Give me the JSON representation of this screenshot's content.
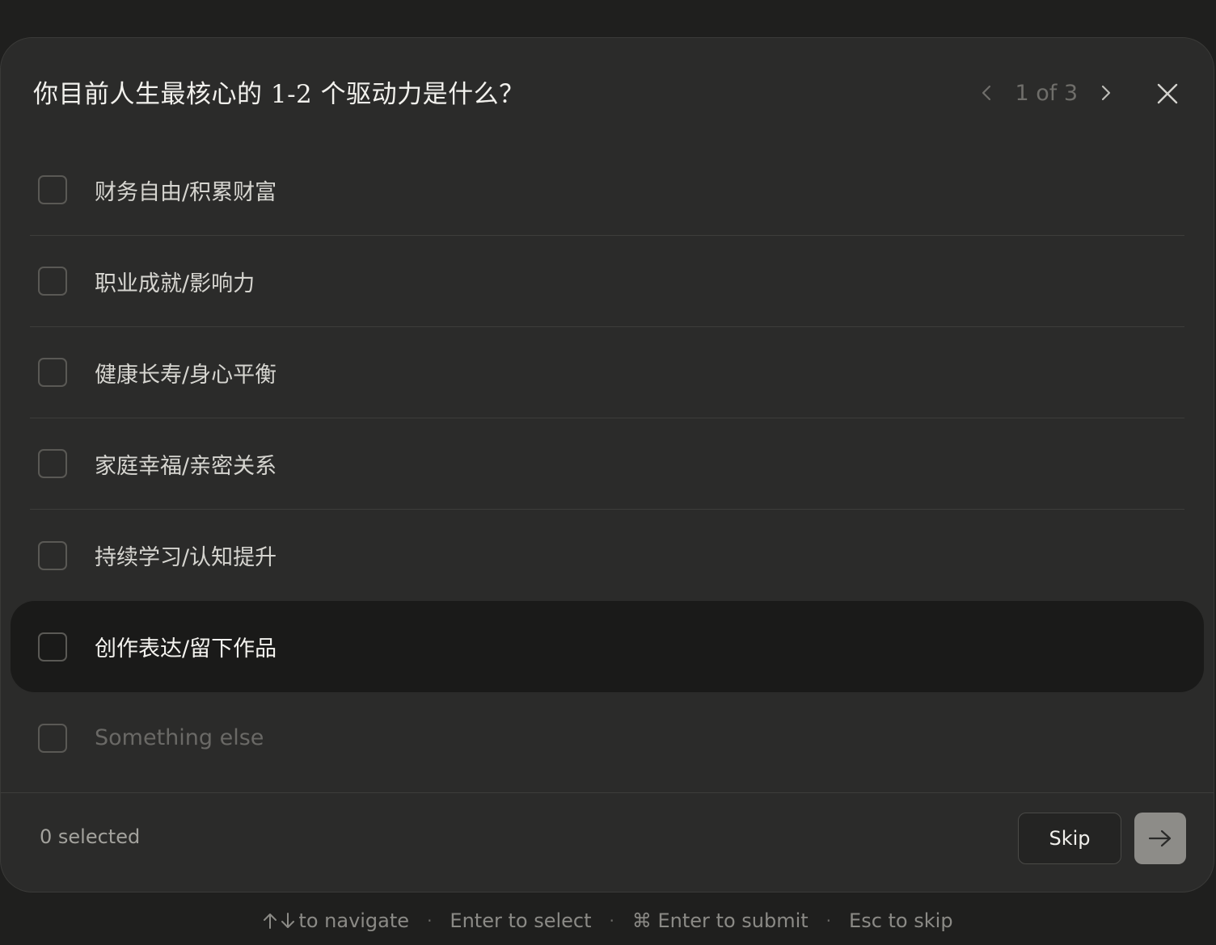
{
  "dialog": {
    "title": "你目前人生最核心的 1-2 个驱动力是什么？",
    "pager": {
      "text": "1 of 3",
      "prev_icon": "chevron-left-icon",
      "next_icon": "chevron-right-icon"
    },
    "close_icon": "close-icon"
  },
  "options": [
    {
      "label": "财务自由/积累财富",
      "checked": false
    },
    {
      "label": "职业成就/影响力",
      "checked": false
    },
    {
      "label": "健康长寿/身心平衡",
      "checked": false
    },
    {
      "label": "家庭幸福/亲密关系",
      "checked": false
    },
    {
      "label": "持续学习/认知提升",
      "checked": false
    },
    {
      "label": "创作表达/留下作品",
      "checked": false,
      "highlighted": true
    },
    {
      "label": "Something else",
      "checked": false,
      "placeholder": true
    }
  ],
  "footer": {
    "selected_count": "0 selected",
    "skip_label": "Skip",
    "submit_icon": "arrow-right-icon"
  },
  "hints": {
    "navigate": "to navigate",
    "select": "Enter to select",
    "submit": "⌘ Enter to submit",
    "skip": "Esc to skip"
  },
  "colors": {
    "background": "#1f1f1e",
    "dialog": "#2b2b2a",
    "highlight_row": "#1a1a19",
    "submit_button": "#8d8c88"
  }
}
